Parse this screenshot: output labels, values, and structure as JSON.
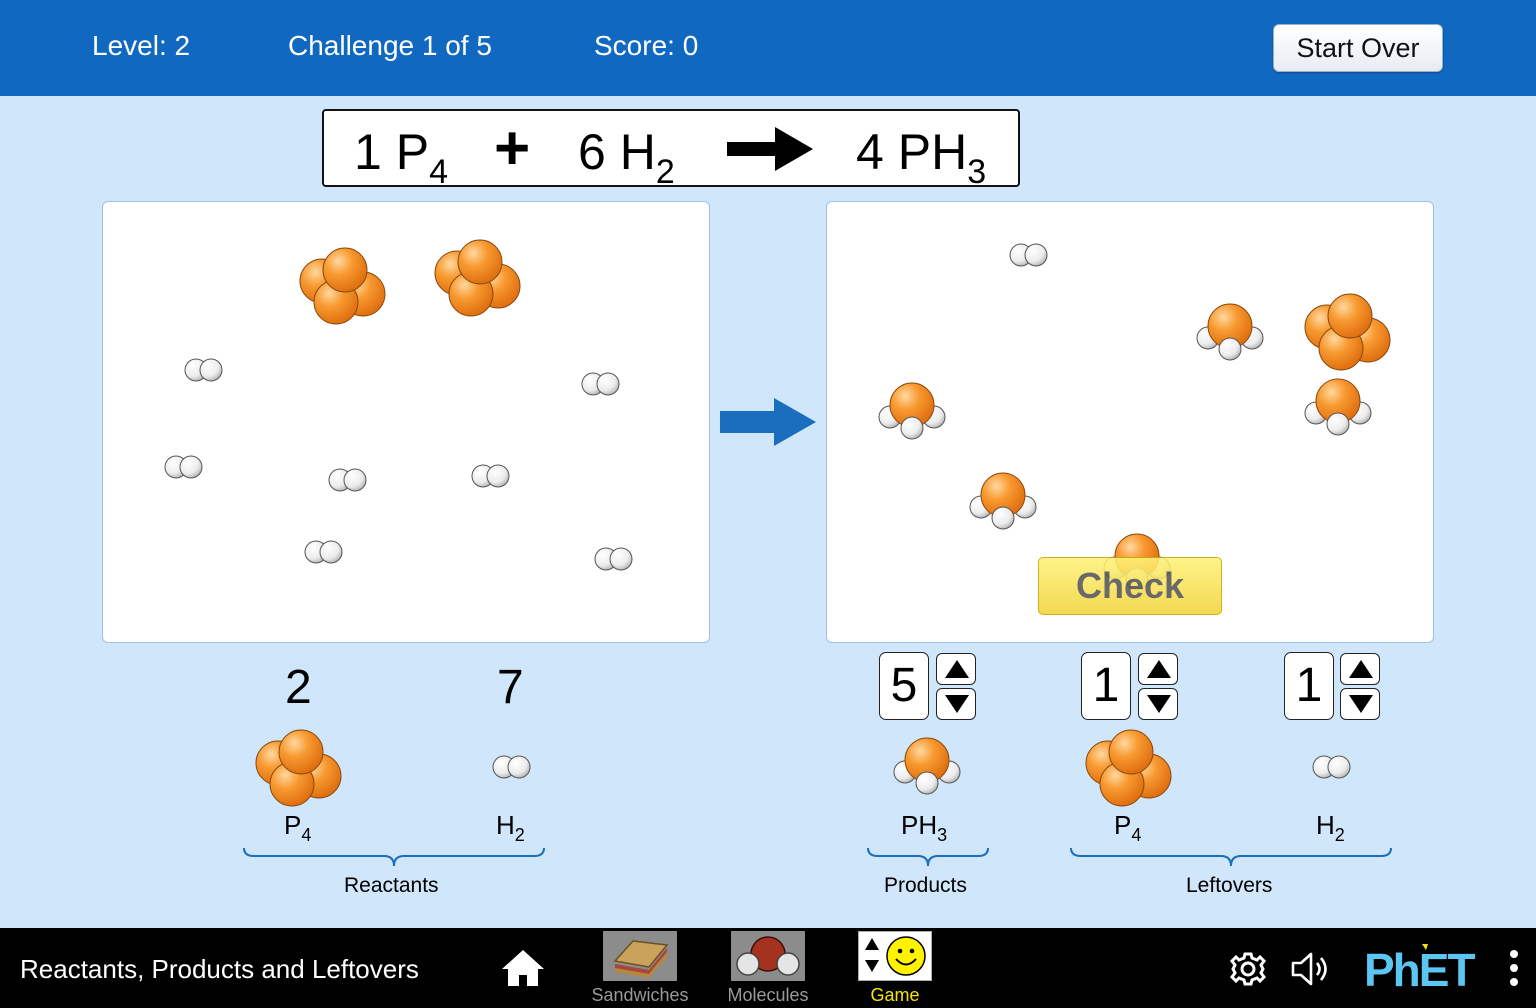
{
  "status": {
    "level": "Level: 2",
    "challenge": "Challenge 1 of 5",
    "score": "Score: 0",
    "start_over": "Start Over"
  },
  "equation": {
    "reactant1_coef": "1",
    "reactant1_symbol": "P",
    "reactant1_sub": "4",
    "plus": "+",
    "reactant2_coef": "6",
    "reactant2_symbol": "H",
    "reactant2_sub": "2",
    "product_coef": "4",
    "product_symbol": "PH",
    "product_sub": "3"
  },
  "check_button": "Check",
  "reactants": {
    "p4_count": "2",
    "h2_count": "7",
    "p4_label": "P",
    "p4_sub": "4",
    "h2_label": "H",
    "h2_sub": "2",
    "group_label": "Reactants"
  },
  "products": {
    "ph3_value": "5",
    "ph3_label": "PH",
    "ph3_sub": "3",
    "group_label": "Products"
  },
  "leftovers": {
    "p4_value": "1",
    "h2_value": "1",
    "p4_label": "P",
    "p4_sub": "4",
    "h2_label": "H",
    "h2_sub": "2",
    "group_label": "Leftovers"
  },
  "navbar": {
    "title": "Reactants, Products and Leftovers",
    "screens": [
      {
        "label": "Sandwiches",
        "selected": false
      },
      {
        "label": "Molecules",
        "selected": false
      },
      {
        "label": "Game",
        "selected": true
      }
    ],
    "brand": "PhET"
  },
  "colors": {
    "topbar": "#1168c1",
    "background": "#d0e6fb",
    "phosphorus": "#f5891f",
    "arrow": "#1b6dbd",
    "check": "#f7de4a",
    "selected_screen": "#f2e600",
    "brand": "#5cc6f2"
  }
}
